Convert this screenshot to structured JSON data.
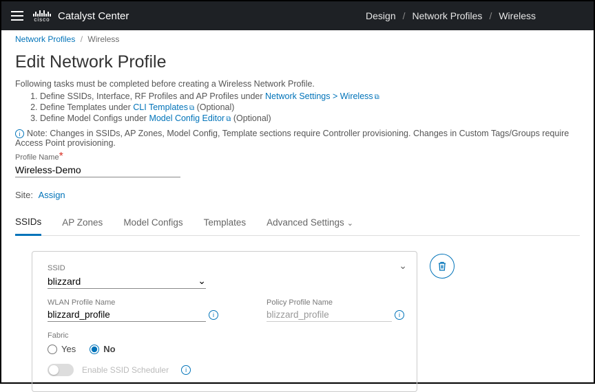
{
  "header": {
    "product": "Catalyst Center",
    "logo_text": "cisco",
    "breadcrumb": [
      "Design",
      "Network Profiles",
      "Wireless"
    ]
  },
  "subcrumb": {
    "parent": "Network Profiles",
    "current": "Wireless"
  },
  "page": {
    "title": "Edit Network Profile",
    "intro": "Following tasks must be completed before creating a Wireless Network Profile.",
    "step1_a": "Define SSIDs, Interface, RF Profiles and AP Profiles under ",
    "step1_link": "Network Settings > Wireless",
    "step2_a": "Define Templates under ",
    "step2_link": "CLI Templates",
    "step2_b": " (Optional)",
    "step3_a": "Define Model Configs under ",
    "step3_link": "Model Config Editor",
    "step3_b": " (Optional)",
    "note": "Note: Changes in SSIDs, AP Zones, Model Config, Template sections require Controller provisioning. Changes in Custom Tags/Groups require Access Point provisioning.",
    "profile_name_label": "Profile Name",
    "profile_name_value": "Wireless-Demo",
    "site_label": "Site:",
    "site_action": "Assign"
  },
  "tabs": [
    "SSIDs",
    "AP Zones",
    "Model Configs",
    "Templates",
    "Advanced Settings"
  ],
  "card": {
    "ssid_label": "SSID",
    "ssid_value": "blizzard",
    "wlan_label": "WLAN Profile Name",
    "wlan_value": "blizzard_profile",
    "policy_label": "Policy Profile Name",
    "policy_value": "blizzard_profile",
    "fabric_label": "Fabric",
    "fabric_yes": "Yes",
    "fabric_no": "No",
    "scheduler_label": "Enable SSID Scheduler"
  }
}
